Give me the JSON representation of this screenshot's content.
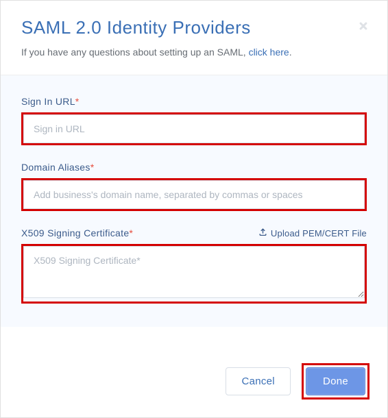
{
  "header": {
    "title": "SAML 2.0 Identity Providers",
    "subtitle_prefix": "If you have any questions about setting up an SAML, ",
    "subtitle_link": "click here",
    "subtitle_suffix": "."
  },
  "fields": {
    "sign_in_url": {
      "label": "Sign In URL",
      "placeholder": "Sign in URL"
    },
    "domain_aliases": {
      "label": "Domain Aliases",
      "placeholder": "Add business's domain name, separated by commas or spaces"
    },
    "cert": {
      "label": "X509 Signing Certificate",
      "placeholder": "X509 Signing Certificate*",
      "upload_label": "Upload PEM/CERT File"
    }
  },
  "footer": {
    "cancel": "Cancel",
    "done": "Done"
  }
}
